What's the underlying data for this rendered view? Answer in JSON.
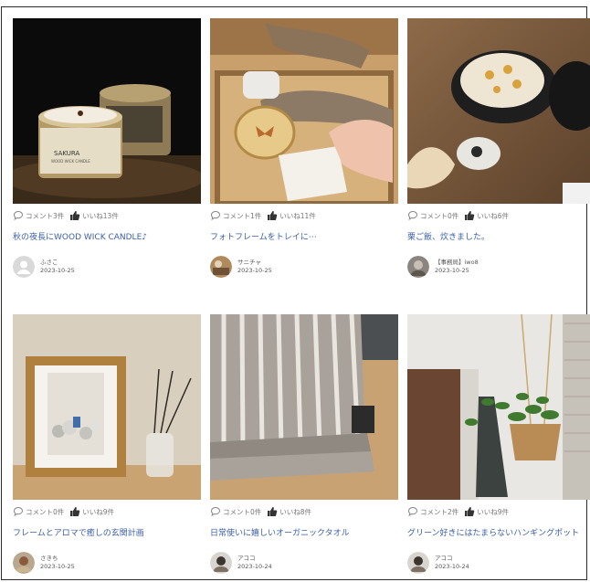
{
  "posts": [
    {
      "comment_label": "コメント",
      "comment_count": "3件",
      "like_label": "いいね",
      "like_count": "13件",
      "title": "秋の夜長にWOOD WICK CANDLE♪",
      "author": "ふさこ",
      "date": "2023-10-25",
      "photo_text_1": "SAKURA",
      "photo_text_2": "WOOD WICK CANDLE",
      "avatar_icon": "default-user-icon"
    },
    {
      "comment_label": "コメント",
      "comment_count": "1件",
      "like_label": "いいね",
      "like_count": "11件",
      "title": "フォトフレームをトレイに⋯",
      "author": "サニチャ",
      "date": "2023-10-25",
      "avatar_icon": "photo-avatar"
    },
    {
      "comment_label": "コメント",
      "comment_count": "0件",
      "like_label": "いいね",
      "like_count": "6件",
      "title": "栗ご飯、炊きました。",
      "author": "【事務局】iwo8",
      "date": "2023-10-25",
      "avatar_icon": "photo-avatar"
    },
    {
      "comment_label": "コメント",
      "comment_count": "0件",
      "like_label": "いいね",
      "like_count": "9件",
      "title": "フレームとアロマで癒しの玄関計画",
      "author": "さきち",
      "date": "2023-10-25",
      "avatar_icon": "photo-avatar"
    },
    {
      "comment_label": "コメント",
      "comment_count": "0件",
      "like_label": "いいね",
      "like_count": "8件",
      "title": "日常使いに嬉しいオーガニックタオル",
      "author": "アココ",
      "date": "2023-10-24",
      "avatar_icon": "photo-avatar"
    },
    {
      "comment_label": "コメント",
      "comment_count": "2件",
      "like_label": "いいね",
      "like_count": "9件",
      "title": "グリーン好きにはたまらないハンギングポット",
      "author": "アココ",
      "date": "2023-10-24",
      "avatar_icon": "photo-avatar"
    }
  ],
  "colors": {
    "link": "#3b5fa8",
    "meta": "#777777",
    "border": "#2b2b2b"
  }
}
